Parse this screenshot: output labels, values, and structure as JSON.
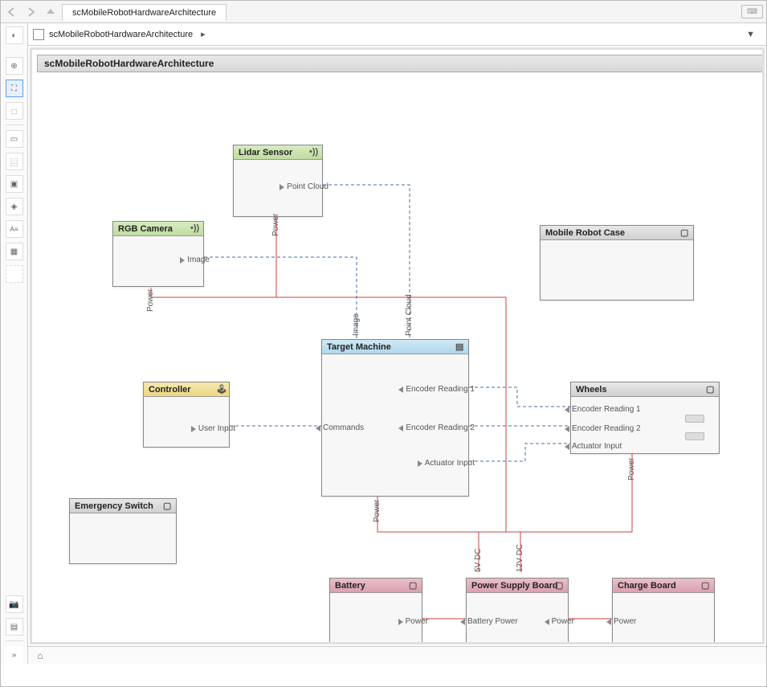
{
  "tab": "scMobileRobotHardwareArchitecture",
  "breadcrumb": "scMobileRobotHardwareArchitecture",
  "canvas_title": "scMobileRobotHardwareArchitecture",
  "blocks": {
    "lidar": {
      "title": "Lidar Sensor",
      "port_out": "Point Cloud",
      "port_pwr": "Power"
    },
    "rgb": {
      "title": "RGB Camera",
      "port_out": "Image",
      "port_pwr": "Power"
    },
    "controller": {
      "title": "Controller",
      "port_out": "User Input"
    },
    "eswitch": {
      "title": "Emergency Switch"
    },
    "target": {
      "title": "Target Machine",
      "p_img": "Image",
      "p_pc": "Point Cloud",
      "p_cmd": "Commands",
      "p_enc1": "Encoder Reading 1",
      "p_enc2": "Encoder Reading 2",
      "p_act": "Actuator Input",
      "p_pwr": "Power"
    },
    "case": {
      "title": "Mobile Robot Case"
    },
    "wheels": {
      "title": "Wheels",
      "p_enc1": "Encoder Reading 1",
      "p_enc2": "Encoder Reading 2",
      "p_act": "Actuator Input",
      "p_pwr": "Power"
    },
    "battery": {
      "title": "Battery",
      "p_pwr": "Power"
    },
    "psb": {
      "title": "Power Supply Board",
      "p_bat": "Battery Power",
      "p_pwr": "Power",
      "p_5v": "5V DC",
      "p_12v": "12V DC"
    },
    "charge": {
      "title": "Charge Board",
      "p_pwr": "Power"
    }
  },
  "wire_labels": {
    "img": "Image",
    "pc": "Point Cloud",
    "pwr": "Power",
    "v5": "5V DC",
    "v12": "12V DC"
  },
  "colors": {
    "green": "#c8e0a8",
    "yellow": "#ecd880",
    "blue": "#b8dcec",
    "gray": "#d8d8d8",
    "pink": "#dcb0b8",
    "wire_data": "#4a6fa5",
    "wire_power": "#d04040"
  }
}
